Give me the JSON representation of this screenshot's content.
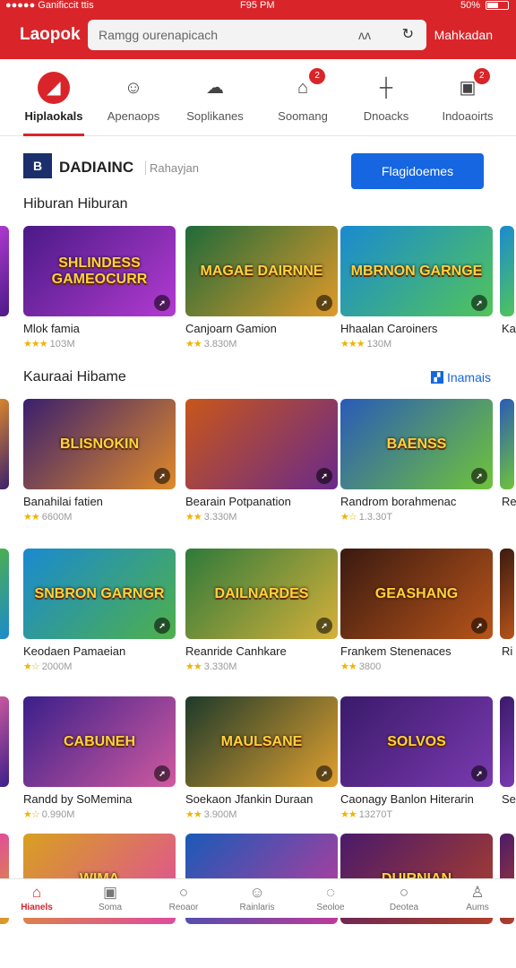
{
  "status": {
    "left": "●●●●● Ganificcit ttis",
    "time": "F95 PM",
    "battery": "50%"
  },
  "header": {
    "logo": "Laopok",
    "search_placeholder": "Ramgg ourenapicach",
    "search_icon_label": "ʌʌ",
    "right_link": "Mahkadan"
  },
  "tabs": [
    {
      "label": "Hiplaokals",
      "icon": "◢",
      "active": true
    },
    {
      "label": "Apenaops",
      "icon": "☺"
    },
    {
      "label": "Soplikanes",
      "icon": "☁"
    },
    {
      "label": "Soomang",
      "icon": "⌂",
      "badge": "2"
    },
    {
      "label": "Dnoacks",
      "icon": "┼"
    },
    {
      "label": "Indoaoirts",
      "icon": "▣",
      "badge": "2"
    }
  ],
  "brand": {
    "logo_text": "B",
    "name": "DADIAINC",
    "sub": "Rahayjan",
    "cta": "Flagidoemes"
  },
  "sections": [
    {
      "title": "Hiburan  Hiburan"
    },
    {
      "title": "Kauraai Hibame",
      "link": "Inamais"
    }
  ],
  "cards": [
    {
      "art": "SHLINDESS GAMEOCURR",
      "title": "Mlok famia",
      "stars": "★★★",
      "meta": "10ЗМ",
      "colors": [
        "#4a1a86",
        "#b33bd1"
      ]
    },
    {
      "art": "MAGAE DAIRNNE",
      "title": "Canjoarn Gamion",
      "stars": "★★",
      "meta": "3.830M",
      "colors": [
        "#1f6a3a",
        "#e09a2a"
      ]
    },
    {
      "art": "MBRNON GARNGE",
      "title": "Hhaalan Caroiners",
      "stars": "★★★",
      "meta": "130M",
      "colors": [
        "#1a8ad0",
        "#52c45a"
      ]
    },
    {
      "art": "BLISNOKIN",
      "title": "Banahilai fatien",
      "stars": "★★",
      "meta": "6600M",
      "colors": [
        "#3a1f6e",
        "#e08a2a"
      ]
    },
    {
      "art": "",
      "title": "Bearain Potpanation",
      "stars": "★★",
      "meta": "3.330M",
      "colors": [
        "#c8561a",
        "#6a2a8a"
      ]
    },
    {
      "art": "BAENSS",
      "title": "Randrom borahmenac",
      "stars": "★☆",
      "meta": "1.3.30T",
      "colors": [
        "#2a5ab8",
        "#6fc43a"
      ]
    },
    {
      "art": "SNBRON GARNGR",
      "title": "Keodaen Pamaeian",
      "stars": "★☆",
      "meta": "2000M",
      "colors": [
        "#1a8ad0",
        "#4fb04a"
      ]
    },
    {
      "art": "DAILNARDES",
      "title": "Reanride Canhkare",
      "stars": "★★",
      "meta": "3.330M",
      "colors": [
        "#2e7a3a",
        "#d6b03a"
      ]
    },
    {
      "art": "GEASHANG",
      "title": "Frankem Stenenaces",
      "stars": "★★",
      "meta": "3800",
      "colors": [
        "#3a1a10",
        "#b8541a"
      ]
    },
    {
      "art": "CABUNEH",
      "title": "Randd by SoMemina",
      "stars": "★☆",
      "meta": "0.990M",
      "colors": [
        "#3a1f8a",
        "#d05aa0"
      ]
    },
    {
      "art": "MAULSANE",
      "title": "Soekaon Jfankin Duraan",
      "stars": "★★",
      "meta": "3.900M",
      "colors": [
        "#1d3a2a",
        "#e0a030"
      ]
    },
    {
      "art": "SOLVOS",
      "title": "Caonagy Banlon Hiterarin",
      "stars": "★★",
      "meta": "13270T",
      "colors": [
        "#3a1a6a",
        "#7a3ab0"
      ]
    },
    {
      "art": "WIMA",
      "title": "",
      "stars": "",
      "meta": "",
      "colors": [
        "#d8a020",
        "#e04aa0"
      ]
    },
    {
      "art": "",
      "title": "",
      "stars": "",
      "meta": "",
      "colors": [
        "#1a5ab8",
        "#c03a9a"
      ]
    },
    {
      "art": "DUIRNIAN",
      "title": "",
      "stars": "",
      "meta": "",
      "colors": [
        "#4a1a6a",
        "#b0402a"
      ]
    }
  ],
  "peek_titles": [
    "Ka",
    "Re",
    "Ri",
    "Se"
  ],
  "bottom_nav": [
    {
      "label": "Hianels",
      "icon": "⌂",
      "active": true
    },
    {
      "label": "Soma",
      "icon": "▣"
    },
    {
      "label": "Reoaor",
      "icon": "○"
    },
    {
      "label": "Rainlaris",
      "icon": "☺"
    },
    {
      "label": "Seoloe",
      "icon": "◌"
    },
    {
      "label": "Deotea",
      "icon": "○"
    },
    {
      "label": "Aums",
      "icon": "♙"
    }
  ]
}
